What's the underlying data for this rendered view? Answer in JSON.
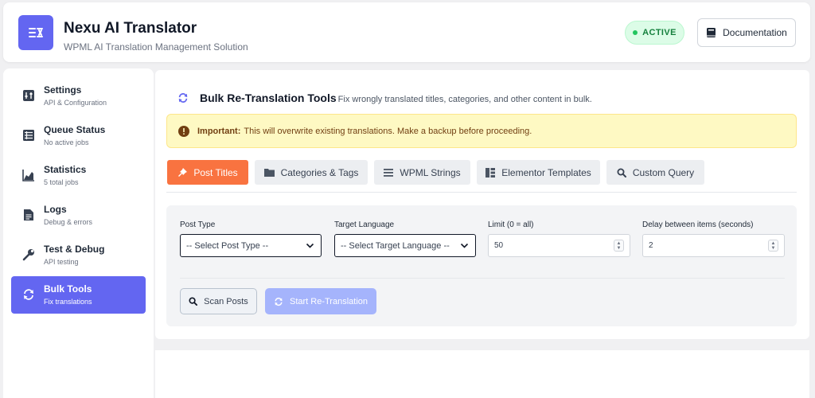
{
  "header": {
    "title": "Nexu AI Translator",
    "subtitle": "WPML AI Translation Management Solution",
    "status": "ACTIVE",
    "doc_button": "Documentation"
  },
  "sidebar": {
    "items": [
      {
        "label": "Settings",
        "sub": "API & Configuration",
        "icon": "sliders-icon"
      },
      {
        "label": "Queue Status",
        "sub": "No active jobs",
        "icon": "list-icon"
      },
      {
        "label": "Statistics",
        "sub": "5 total jobs",
        "icon": "chart-icon"
      },
      {
        "label": "Logs",
        "sub": "Debug & errors",
        "icon": "file-icon"
      },
      {
        "label": "Test & Debug",
        "sub": "API testing",
        "icon": "wrench-icon"
      },
      {
        "label": "Bulk Tools",
        "sub": "Fix translations",
        "icon": "sync-icon",
        "active": true
      }
    ]
  },
  "main": {
    "title": "Bulk Re-Translation Tools",
    "description": "Fix wrongly translated titles, categories, and other content in bulk.",
    "alert": {
      "strong": "Important:",
      "text": "This will overwrite existing translations. Make a backup before proceeding."
    },
    "tabs": [
      {
        "label": "Post Titles",
        "icon": "pin-icon",
        "active": true
      },
      {
        "label": "Categories & Tags",
        "icon": "folder-icon"
      },
      {
        "label": "WPML Strings",
        "icon": "menu-icon"
      },
      {
        "label": "Elementor Templates",
        "icon": "elementor-icon"
      },
      {
        "label": "Custom Query",
        "icon": "search-icon"
      }
    ],
    "form": {
      "post_type": {
        "label": "Post Type",
        "value": "-- Select Post Type --"
      },
      "target_language": {
        "label": "Target Language",
        "value": "-- Select Target Language --"
      },
      "limit": {
        "label": "Limit (0 = all)",
        "value": "50"
      },
      "delay": {
        "label": "Delay between items (seconds)",
        "value": "2"
      }
    },
    "buttons": {
      "scan": "Scan Posts",
      "start": "Start Re-Translation"
    }
  },
  "colors": {
    "accent": "#6366f1",
    "tab_active": "#f97340",
    "status_green": "#22c55e",
    "alert_bg": "#fef9c3"
  }
}
